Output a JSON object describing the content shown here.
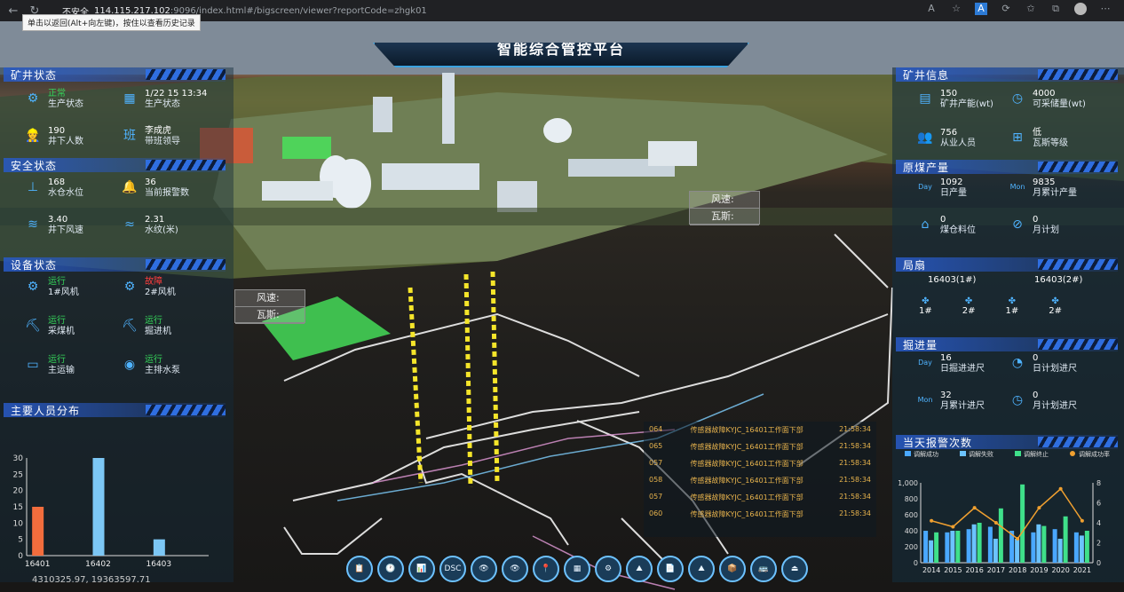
{
  "browser": {
    "security_label": "不安全",
    "url_host": "114.115.217.102",
    "url_path": ":9096/index.html#/bigscreen/viewer?reportCode=zhgk01",
    "back_tooltip": "单击以返回(Alt+向左键)，按住以查看历史记录"
  },
  "app": {
    "title": "智能综合管控平台",
    "coords": "4310325.97, 19363597.71"
  },
  "left": {
    "mine_status": {
      "title": "矿井状态",
      "items": [
        {
          "value": "正常",
          "label": "生产状态"
        },
        {
          "value": "1/22 15 13:34",
          "label": "生产状态"
        },
        {
          "value": "190",
          "label": "井下人数"
        },
        {
          "value": "李成虎",
          "label": "带班领导"
        }
      ]
    },
    "safety_status": {
      "title": "安全状态",
      "items": [
        {
          "value": "168",
          "label": "水仓水位"
        },
        {
          "value": "36",
          "label": "当前报警数"
        },
        {
          "value": "3.40",
          "label": "井下风速"
        },
        {
          "value": "2.31",
          "label": "水纹(米)"
        }
      ]
    },
    "equip_status": {
      "title": "设备状态",
      "items": [
        {
          "value": "运行",
          "label": "1#风机"
        },
        {
          "value": "故障",
          "label": "2#风机"
        },
        {
          "value": "运行",
          "label": "采煤机"
        },
        {
          "value": "运行",
          "label": "掘进机"
        },
        {
          "value": "运行",
          "label": "主运输"
        },
        {
          "value": "运行",
          "label": "主排水泵"
        }
      ]
    },
    "personnel_title": "主要人员分布"
  },
  "right": {
    "mine_info": {
      "title": "矿井信息",
      "items": [
        {
          "value": "150",
          "label": "矿井产能(wt)"
        },
        {
          "value": "4000",
          "label": "可采储量(wt)"
        },
        {
          "value": "756",
          "label": "从业人员"
        },
        {
          "value": "低",
          "label": "瓦斯等级"
        }
      ]
    },
    "coal_output": {
      "title": "原煤产量",
      "items": [
        {
          "value": "1092",
          "label": "日产量",
          "icon": "Day"
        },
        {
          "value": "9835",
          "label": "月累计产量",
          "icon": "Mon"
        },
        {
          "value": "0",
          "label": "煤仓料位"
        },
        {
          "value": "0",
          "label": "月计划"
        }
      ]
    },
    "local_fan": {
      "title": "局扇",
      "groups": [
        "16403(1#)",
        "16403(2#)"
      ],
      "fans": [
        "1#",
        "2#",
        "1#",
        "2#"
      ]
    },
    "tunneling": {
      "title": "掘进量",
      "items": [
        {
          "value": "16",
          "label": "日掘进进尺",
          "icon": "Day"
        },
        {
          "value": "0",
          "label": "日计划进尺"
        },
        {
          "value": "32",
          "label": "月累计进尺",
          "icon": "Mon"
        },
        {
          "value": "0",
          "label": "月计划进尺"
        }
      ]
    },
    "alarm_title": "当天报警次数"
  },
  "wind_labels": {
    "speed": "风速:",
    "gas": "瓦斯:"
  },
  "alarms": [
    {
      "id": "064",
      "msg": "传感器故障KYJC_16401工作面下部",
      "time": "21:58:34"
    },
    {
      "id": "065",
      "msg": "传感器故障KYJC_16401工作面下部",
      "time": "21:58:34"
    },
    {
      "id": "057",
      "msg": "传感器故障KYJC_16401工作面下部",
      "time": "21:58:34"
    },
    {
      "id": "058",
      "msg": "传感器故障KYJC_16401工作面下部",
      "time": "21:58:34"
    },
    {
      "id": "057",
      "msg": "传感器故障KYJC_16401工作面下部",
      "time": "21:58:34"
    },
    {
      "id": "060",
      "msg": "传感器故障KYJC_16401工作面下部",
      "time": "21:58:34"
    }
  ],
  "toolbar": [
    "📋",
    "🕐",
    "📊",
    "DSC",
    "👁",
    "👁",
    "📍",
    "▦",
    "⚙",
    "⛰",
    "📄",
    "⛰",
    "📦",
    "🚌",
    "⏏"
  ],
  "colors": {
    "bar1": "#f26d3d",
    "bar2": "#7cc7f5",
    "bar3": "#7cc7f5"
  },
  "chart_data": [
    {
      "type": "bar",
      "title": "主要人员分布",
      "categories": [
        "16401",
        "16402",
        "16403"
      ],
      "values": [
        15,
        30,
        5
      ],
      "ylim": [
        0,
        30
      ],
      "yticks": [
        0,
        5,
        10,
        15,
        20,
        25,
        30
      ]
    },
    {
      "type": "bar",
      "title": "当天报警次数",
      "legend": [
        "调解成功",
        "调解失败",
        "调解终止",
        "调解成功率"
      ],
      "categories": [
        "2014",
        "2015",
        "2016",
        "2017",
        "2018",
        "2019",
        "2020",
        "2021"
      ],
      "series": [
        {
          "name": "调解成功",
          "values": [
            400,
            380,
            420,
            450,
            400,
            380,
            420,
            380
          ]
        },
        {
          "name": "调解失败",
          "values": [
            280,
            400,
            480,
            300,
            300,
            480,
            300,
            340
          ]
        },
        {
          "name": "调解终止",
          "values": [
            380,
            400,
            500,
            680,
            980,
            460,
            580,
            400
          ]
        },
        {
          "name": "调解成功率",
          "values": [
            4.2,
            3.6,
            5.5,
            4.0,
            2.4,
            5.5,
            7.4,
            4.2
          ]
        }
      ],
      "ylim": [
        0,
        1000
      ],
      "y2lim": [
        0,
        8
      ],
      "yticks": [
        "0",
        "200",
        "400",
        "600",
        "800",
        "1,000"
      ],
      "y2ticks": [
        "0",
        "2",
        "4",
        "6",
        "8"
      ]
    }
  ]
}
